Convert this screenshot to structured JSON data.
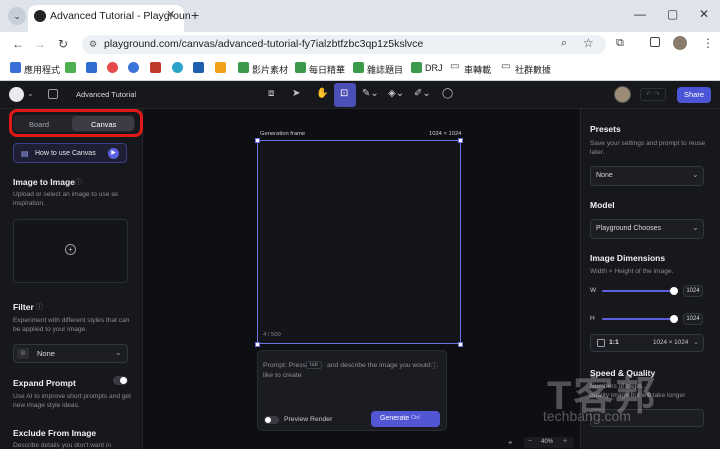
{
  "browser": {
    "tab_title": "Advanced Tutorial - Playgroun",
    "tab_close": "✕",
    "new_tab": "+",
    "url": "playground.com/canvas/advanced-tutorial-fy7ialzbtfzbc3qp1z5kslvce",
    "window_controls": [
      "—",
      "▢",
      "✕"
    ],
    "bookmarks": [
      "應用程式",
      "影片素材",
      "每日精華",
      "雜誌題目",
      "DRJ",
      "車轉載",
      "社群數據"
    ]
  },
  "app": {
    "title": "Advanced Tutorial",
    "share_label": "Share",
    "segment": {
      "board": "Board",
      "canvas": "Canvas"
    },
    "how_to_label": "How to use Canvas",
    "left": {
      "image_to_image": {
        "title": "Image to Image",
        "desc": "Upload or select an image to use as inspiration."
      },
      "filter": {
        "title": "Filter",
        "desc": "Experiment with different styles that can be applied to your image.",
        "value": "None"
      },
      "expand_prompt": {
        "title": "Expand Prompt",
        "desc": "Use AI to improve short prompts and get new image style ideas."
      },
      "exclude": {
        "title": "Exclude From Image",
        "desc": "Describe details you don't want in"
      }
    },
    "canvas": {
      "frame_label": "Generation frame",
      "frame_size": "1024 × 1024",
      "counter": "4 / 500",
      "prompt_a": "Prompt: Press",
      "prompt_key": "tab",
      "prompt_b": "and describe the image you would",
      "prompt_c": "like to create",
      "preview_label": "Preview Render",
      "generate_label": "Generate",
      "generate_kbd": "Ctrl",
      "zoom": "40%",
      "zoom_minus": "−",
      "zoom_plus": "+"
    },
    "right": {
      "presets": {
        "title": "Presets",
        "desc": "Save your settings and prompt to reuse later.",
        "value": "None"
      },
      "model": {
        "title": "Model",
        "value": "Playground Chooses"
      },
      "dims": {
        "title": "Image Dimensions",
        "desc": "Width × Height of the image.",
        "w_label": "W",
        "w_value": "1024",
        "w_level": 1.0,
        "h_label": "H",
        "h_value": "1024",
        "h_level": 1.0,
        "ratio": "1:1",
        "ratio_size": "1024 × 1024"
      },
      "speed": {
        "title": "Speed & Quality",
        "desc_a": "Numbers of steps...",
        "desc_b": "quality image but will take longer"
      }
    }
  },
  "watermark": {
    "brand": "T客邦",
    "site": "techbang.com"
  },
  "colors": {
    "accent": "#5b5fe0",
    "share": "#4a56d6",
    "highlight_box": "#e11818"
  }
}
